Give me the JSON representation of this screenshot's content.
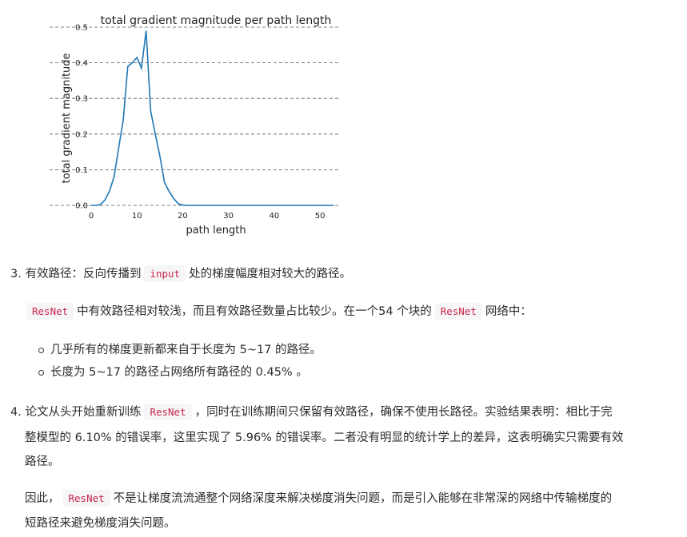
{
  "chart_data": {
    "type": "line",
    "title": "total gradient magnitude per path length",
    "xlabel": "path length",
    "ylabel": "total gradient magnitude",
    "xlim": [
      0,
      54
    ],
    "ylim": [
      0,
      0.5
    ],
    "xticks": [
      "0",
      "10",
      "20",
      "30",
      "40",
      "50"
    ],
    "yticks": [
      "0.0",
      "0.1",
      "0.2",
      "0.3",
      "0.4",
      "0.5"
    ],
    "grid": "horizontal dashed",
    "line_color": "#1f77b4",
    "x": [
      0,
      1,
      2,
      3,
      4,
      5,
      6,
      7,
      8,
      9,
      10,
      11,
      12,
      13,
      14,
      15,
      16,
      17,
      18,
      19,
      20,
      21,
      22,
      23,
      24,
      25,
      26,
      27,
      28,
      29,
      30,
      31,
      32,
      33,
      34,
      35,
      36,
      37,
      38,
      39,
      40,
      41,
      42,
      43,
      44,
      45,
      46,
      47,
      48,
      49,
      50,
      51,
      52,
      53
    ],
    "values": [
      0,
      0,
      0.002,
      0.015,
      0.04,
      0.08,
      0.16,
      0.24,
      0.39,
      0.4,
      0.415,
      0.385,
      0.49,
      0.265,
      0.2,
      0.14,
      0.065,
      0.04,
      0.02,
      0.005,
      0.001,
      0,
      0,
      0,
      0,
      0,
      0,
      0,
      0,
      0,
      0,
      0,
      0,
      0,
      0,
      0,
      0,
      0,
      0,
      0,
      0,
      0,
      0,
      0,
      0,
      0,
      0,
      0,
      0,
      0,
      0,
      0,
      0,
      0
    ]
  },
  "item3": {
    "num": "3.",
    "pre": "有效路径：反向传播到",
    "code": "input",
    "post": "处的梯度幅度相对较大的路径。"
  },
  "resnet_line": {
    "code1": "ResNet",
    "mid": "中有效路径相对较浅，而且有效路径数量占比较少。在一个54 个块的",
    "code2": "ResNet",
    "post": "网络中："
  },
  "bullets": [
    "几乎所有的梯度更新都来自于长度为 5~17 的路径。",
    "长度为 5~17 的路径占网络所有路径的 0.45% 。"
  ],
  "item4": {
    "num": "4.",
    "pre": "论文从头开始重新训练",
    "code": "ResNet",
    "line1_post": "，同时在训练期间只保留有效路径，确保不使用长路径。实验结果表明：相比于完",
    "line2": "整模型的 6.10% 的错误率，这里实现了 5.96% 的错误率。二者没有明显的统计学上的差异，这表明确实只需要有效",
    "line3": "路径。"
  },
  "conclusion": {
    "pre": "因此，",
    "code": "ResNet",
    "line1_post": "不是让梯度流流通整个网络深度来解决梯度消失问题，而是引入能够在非常深的网络中传输梯度的",
    "line2": "短路径来避免梯度消失问题。"
  }
}
